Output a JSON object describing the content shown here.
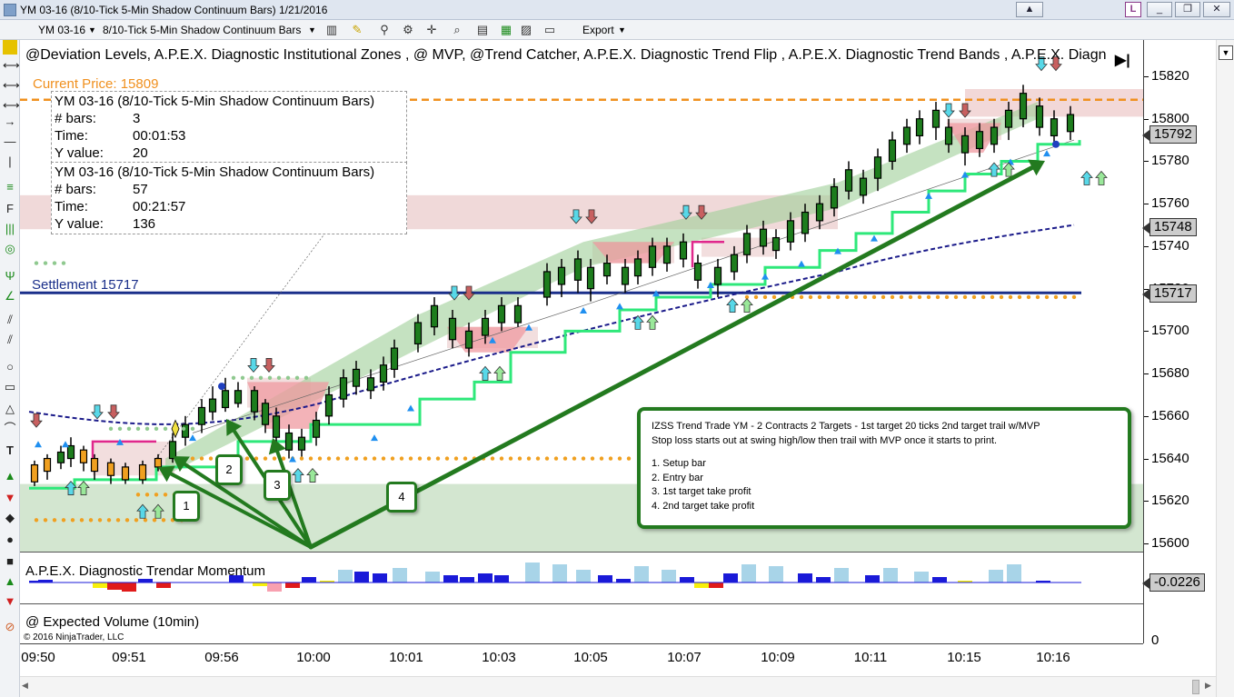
{
  "window": {
    "title": "YM 03-16 (8/10-Tick 5-Min Shadow Continuum Bars)  1/21/2016",
    "buttons": {
      "menu": "▲",
      "restore": "❐",
      "close": "✕"
    },
    "badge": "L"
  },
  "toolbar": {
    "instrument": "YM 03-16",
    "bartype": "8/10-Tick 5-Min Shadow Continuum Bars",
    "export": "Export"
  },
  "chart": {
    "indicators_title": "@Deviation Levels, A.P.E.X. Diagnostic Institutional Zones , @ MVP, @Trend Catcher, A.P.E.X. Diagnostic Trend Flip , A.P.E.X. Diagnostic Trend Bands , A.P.E.X. Diagn",
    "current_price_label": "Current Price: 15809",
    "settlement_label": "Settlement 15717",
    "price_boxes": [
      "15792",
      "15748",
      "15717"
    ],
    "y_ticks": [
      "15820",
      "15800",
      "15780",
      "15760",
      "15740",
      "15720",
      "15700",
      "15680",
      "15660",
      "15640",
      "15620",
      "15600"
    ],
    "x_ticks": [
      "09:50",
      "09:51",
      "09:56",
      "10:00",
      "10:01",
      "10:03",
      "10:05",
      "10:07",
      "10:09",
      "10:11",
      "10:15",
      "10:16"
    ],
    "copyright": "© 2016 NinjaTrader, LLC",
    "colors": {
      "current_price": "#f0901e",
      "settlement": "#1a2f8a",
      "trend_step": "#2ee87a",
      "mvp": "#1b1b8a",
      "callout": "#237a1f"
    }
  },
  "tooltips": [
    {
      "title": "YM 03-16 (8/10-Tick 5-Min Shadow Continuum Bars)",
      "bars_label": "# bars:",
      "bars": "3",
      "time_label": "Time:",
      "time": "00:01:53",
      "y_label": "Y value:",
      "y": "20"
    },
    {
      "title": "YM 03-16 (8/10-Tick 5-Min Shadow Continuum Bars)",
      "bars_label": "# bars:",
      "bars": "57",
      "time_label": "Time:",
      "time": "00:21:57",
      "y_label": "Y value:",
      "y": "136"
    }
  ],
  "callouts": [
    "1",
    "2",
    "3",
    "4"
  ],
  "note": {
    "line1": "IZSS Trend Trade YM - 2 Contracts 2 Targets - 1st target 20 ticks 2nd target trail w/MVP",
    "line2": "Stop loss starts out at swing high/low then trail with MVP once it starts to print.",
    "items": [
      "1. Setup bar",
      "2. Entry bar",
      "3. 1st target take profit",
      "4. 2nd target take profit"
    ]
  },
  "momentum": {
    "label": "A.P.E.X. Diagnostic Trendar Momentum",
    "value": "-0.0226"
  },
  "volume": {
    "label": "@ Expected Volume (10min)",
    "axis_zero": "0"
  }
}
